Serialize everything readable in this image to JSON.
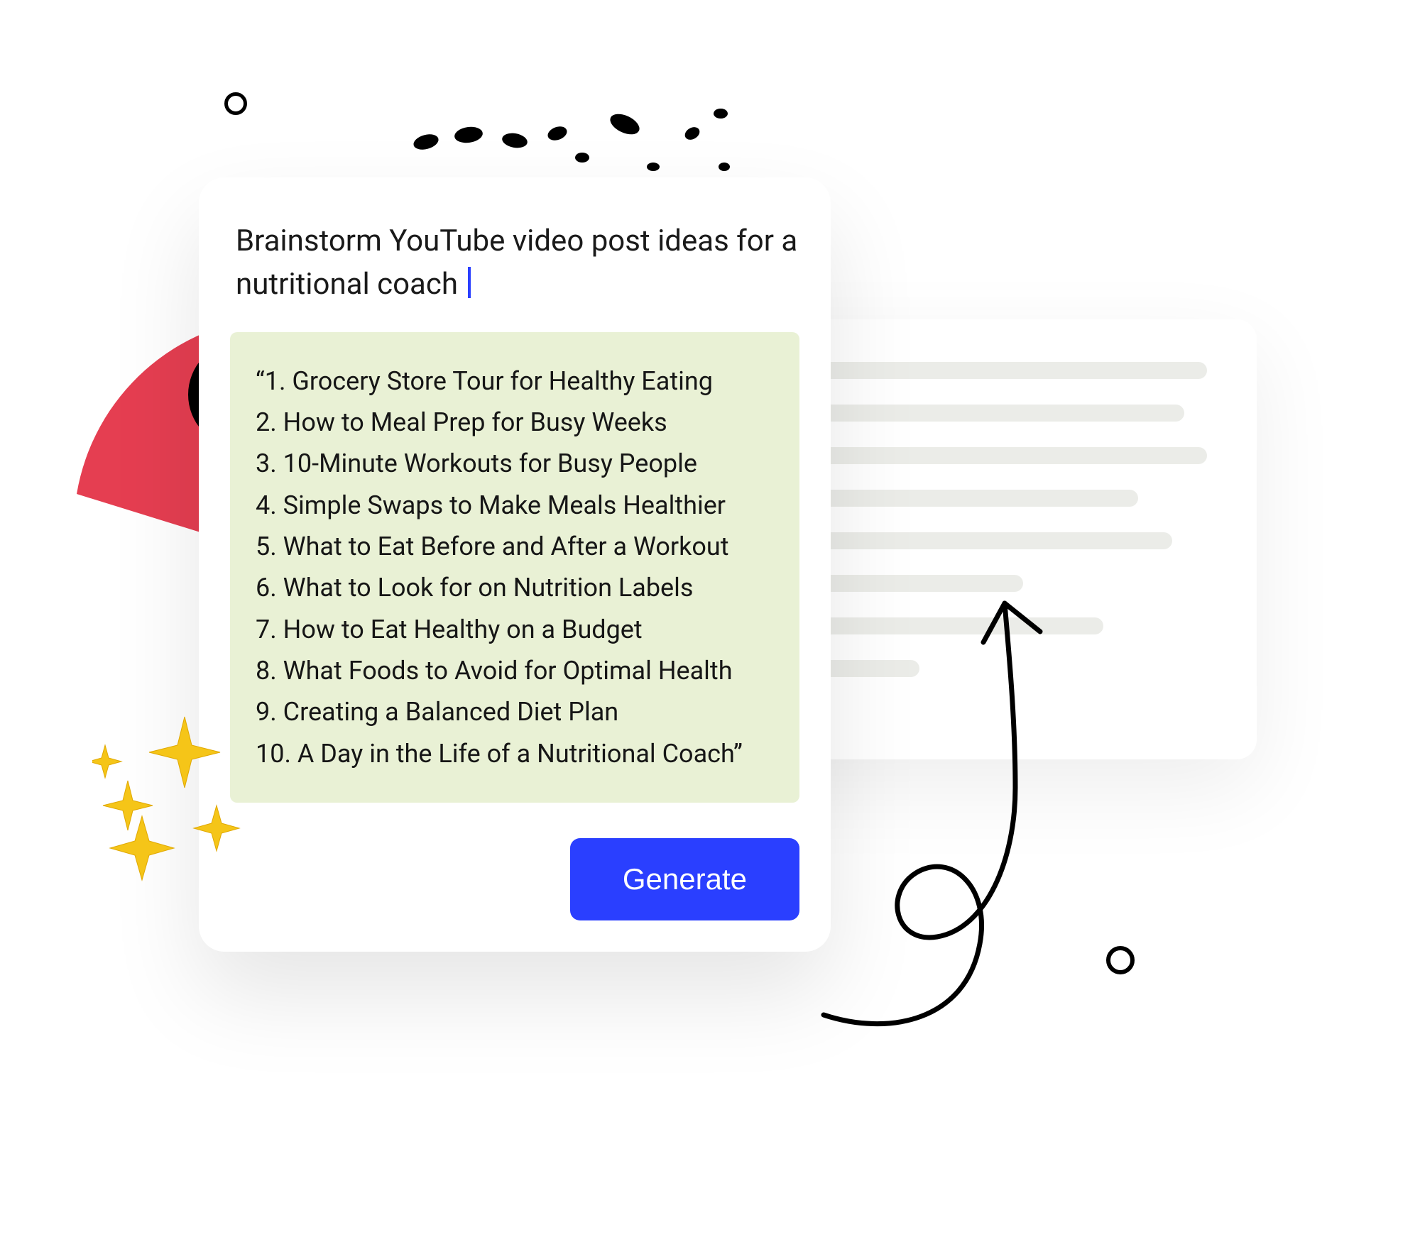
{
  "prompt_text": "Brainstorm YouTube video post ideas for a nutritional coach ",
  "result_prefix": "“",
  "result_suffix": "”",
  "result_items": [
    "1. Grocery Store Tour for Healthy Eating",
    "2. How to Meal Prep for Busy Weeks",
    "3. 10-Minute Workouts for Busy People",
    "4. Simple Swaps to Make Meals Healthier",
    "5. What to Eat Before and After a Workout",
    "6. What to Look for on Nutrition Labels",
    "7. How to Eat Healthy on a Budget",
    "8. What Foods to Avoid for Optimal Health",
    "9. Creating a Balanced Diet Plan",
    "10. A Day in the Life of a Nutritional Coach"
  ],
  "button_label": "Generate",
  "colors": {
    "accent": "#2a3fff",
    "result_bg": "#e9f1d5",
    "wedge": "#e53e51",
    "sparkle": "#f5c518"
  }
}
